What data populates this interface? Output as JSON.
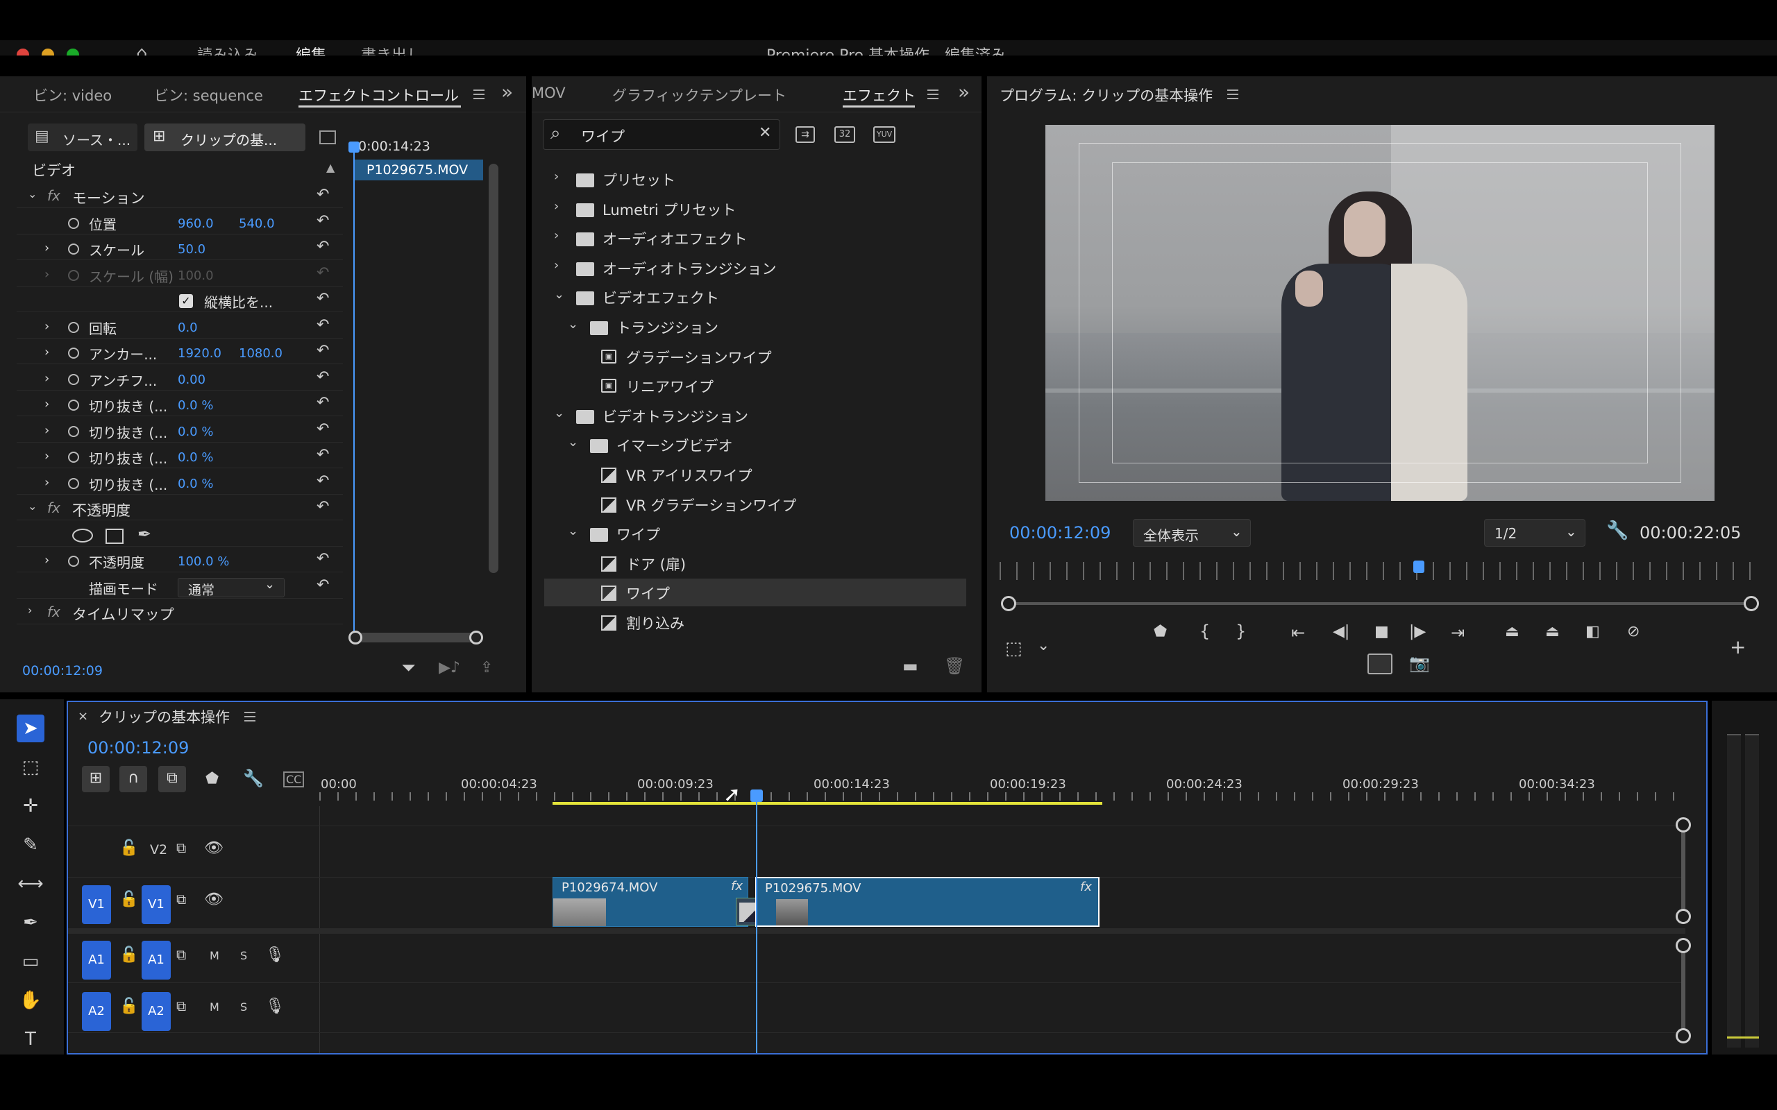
{
  "window": {
    "title": "Premiere Pro 基本操作 - 編集済み",
    "menu": [
      "読み込み",
      "編集",
      "書き出し"
    ],
    "active_menu": "編集"
  },
  "source_panel": {
    "tabs": [
      "ビン: video",
      "ビン: sequence",
      "エフェクトコントロール"
    ],
    "active_tab": "エフェクトコントロール",
    "source_btn": "ソース・...",
    "clip_btn": "クリップの基...",
    "ruler_time": "0:00:14:23",
    "clip_name": "P1029675.MOV",
    "section_video": "ビデオ",
    "rows": [
      {
        "label": "モーション",
        "indent": 0,
        "type": "fx-group"
      },
      {
        "label": "位置",
        "v1": "960.0",
        "v2": "540.0"
      },
      {
        "label": "スケール",
        "v1": "50.0"
      },
      {
        "label": "スケール (幅)",
        "v1": "100.0",
        "disabled": true
      },
      {
        "label": "縦横比を...",
        "type": "checkbox"
      },
      {
        "label": "回転",
        "v1": "0.0"
      },
      {
        "label": "アンカー...",
        "v1": "1920.0",
        "v2": "1080.0"
      },
      {
        "label": "アンチフ...",
        "v1": "0.00"
      },
      {
        "label": "切り抜き (...",
        "v1": "0.0 %"
      },
      {
        "label": "切り抜き (...",
        "v1": "0.0 %"
      },
      {
        "label": "切り抜き (...",
        "v1": "0.0 %"
      },
      {
        "label": "切り抜き (...",
        "v1": "0.0 %"
      },
      {
        "label": "不透明度",
        "type": "fx-group"
      },
      {
        "label": "",
        "type": "masks"
      },
      {
        "label": "不透明度",
        "v1": "100.0 %"
      },
      {
        "label": "描画モード",
        "v1": "通常",
        "type": "dropdown"
      },
      {
        "label": "タイムリマップ",
        "type": "fx-group-collapsed"
      }
    ],
    "timecode": "00:00:12:09"
  },
  "effects_panel": {
    "tabs": [
      "MOV",
      "グラフィックテンプレート",
      "エフェクト"
    ],
    "active_tab": "エフェクト",
    "search_value": "ワイプ",
    "badges": [
      "32",
      "YUV"
    ],
    "tree": [
      {
        "label": "プリセット",
        "level": 0,
        "open": false,
        "kind": "star-folder"
      },
      {
        "label": "Lumetri プリセット",
        "level": 0,
        "open": false,
        "kind": "star-folder"
      },
      {
        "label": "オーディオエフェクト",
        "level": 0,
        "open": false,
        "kind": "folder"
      },
      {
        "label": "オーディオトランジション",
        "level": 0,
        "open": false,
        "kind": "folder"
      },
      {
        "label": "ビデオエフェクト",
        "level": 0,
        "open": true,
        "kind": "folder"
      },
      {
        "label": "トランジション",
        "level": 1,
        "open": true,
        "kind": "folder"
      },
      {
        "label": "グラデーションワイプ",
        "level": 2,
        "kind": "fx"
      },
      {
        "label": "リニアワイプ",
        "level": 2,
        "kind": "fx"
      },
      {
        "label": "ビデオトランジション",
        "level": 0,
        "open": true,
        "kind": "folder"
      },
      {
        "label": "イマーシブビデオ",
        "level": 1,
        "open": true,
        "kind": "folder"
      },
      {
        "label": "VR アイリスワイプ",
        "level": 2,
        "kind": "tr"
      },
      {
        "label": "VR グラデーションワイプ",
        "level": 2,
        "kind": "tr"
      },
      {
        "label": "ワイプ",
        "level": 1,
        "open": true,
        "kind": "folder"
      },
      {
        "label": "ドア (扉)",
        "level": 2,
        "kind": "tr"
      },
      {
        "label": "ワイプ",
        "level": 2,
        "kind": "tr",
        "selected": true
      },
      {
        "label": "割り込み",
        "level": 2,
        "kind": "tr"
      }
    ]
  },
  "program_panel": {
    "title": "プログラム: クリップの基本操作",
    "timecode": "00:00:12:09",
    "zoom": "全体表示",
    "resolution": "1/2",
    "duration": "00:00:22:05"
  },
  "timeline": {
    "title": "クリップの基本操作",
    "timecode": "00:00:12:09",
    "ruler": [
      "00:00",
      "00:00:04:23",
      "00:00:09:23",
      "00:00:14:23",
      "00:00:19:23",
      "00:00:24:23",
      "00:00:29:23",
      "00:00:34:23"
    ],
    "tracks": {
      "v2": "V2",
      "v1_src": "V1",
      "v1": "V1",
      "a1_src": "A1",
      "a1": "A1",
      "a2_src": "A2",
      "a2": "A2",
      "m": "M",
      "s": "S"
    },
    "clips": [
      {
        "name": "P1029674.MOV"
      },
      {
        "name": "P1029675.MOV"
      }
    ]
  },
  "colors": {
    "accent": "#4a9bff",
    "track_button": "#2a64d6",
    "clip": "#1f5f8b",
    "work_area": "#e3e33a"
  }
}
